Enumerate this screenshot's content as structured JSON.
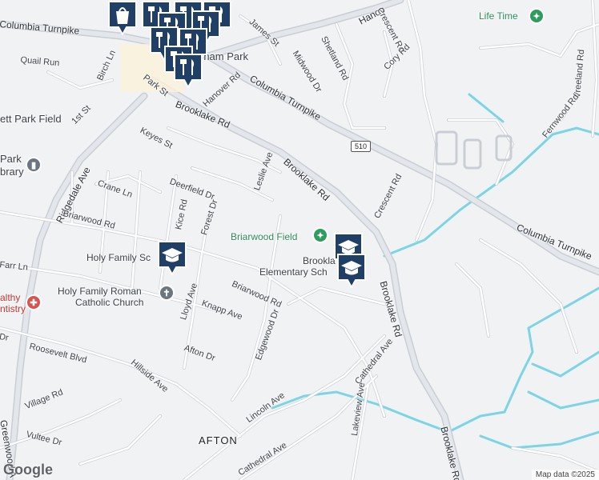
{
  "map": {
    "colors": {
      "background": "#f1f2f4",
      "road": "#ffffff",
      "major_road": "#d8dde3",
      "water": "#7cd4e6",
      "pin": "#1f3f66"
    },
    "labels": {
      "life_time": "Life Time",
      "hanover": "Hanov",
      "crescent_rd_top": "Crescent Rd",
      "james_st": "James St",
      "shetland_rd": "Shetland Rd",
      "midwood_dr": "Midwood Dr",
      "cory_rd": "Cory Rd",
      "vreeland_rd": "Vreeland Rd",
      "columbia_tpke_left": "Columbia Turnpike",
      "quail_run": "Quail Run",
      "florham_park": "rham Park",
      "birch_ln": "Birch Ln",
      "park_st": "Park St",
      "hanover_rd": "Hanover Rd",
      "columbia_tpke_mid": "Columbia Turnpike",
      "fernwood_rd": "Fernwood Rd",
      "ett_park_field": "ett Park Field",
      "first_st": "1st St",
      "brooklake_rd_top": "Brooklake Rd",
      "keyes_st": "Keyes St",
      "route_510": "510",
      "park_partial": "Park",
      "library_partial": "brary",
      "ridgedale_ave": "Ridgedale Ave",
      "crane_ln": "Crane Ln",
      "deerfield_dr": "Deerfield Dr",
      "leslie_ave": "Leslie Ave",
      "brooklake_rd_mid": "Brooklake Rd",
      "crescent_rd_mid": "Crescent Rd",
      "kice_rd": "Kice Rd",
      "forest_dr": "Forest Dr",
      "briarwood_rd_left": "Briarwood Rd",
      "briarwood_field": "Briarwood Field",
      "columbia_tpke_right": "Columbia Turnpike",
      "farr_ln": "Farr Ln",
      "holy_family_sch": "Holy Family Sc",
      "brooklake_elem_1": "Brookla",
      "brooklake_elem_2": "Elementary Sch",
      "brooklake_rd_right": "Brooklake Rd",
      "holy_family_church_1": "Holy Family Roman",
      "holy_family_church_2": "Catholic Church",
      "lloyd_ave": "Lloyd Ave",
      "briarwood_rd_mid": "Briarwood Rd",
      "knapp_ave": "Knapp Ave",
      "healthy_1": "althy",
      "healthy_2": "ntistry",
      "edgewood_dr": "Edgewood Dr",
      "afton_dr": "Afton Dr",
      "roosevelt_blvd": "Roosevelt Blvd",
      "dr_partial": "Dr",
      "cathedral_ave_right": "Cathedral Ave",
      "hillside_ave": "Hillside Ave",
      "village_rd": "Village Rd",
      "lincoln_ave": "Lincoln Ave",
      "lakeview_ave": "Lakeview Ave",
      "greenwood_ave": "Greenwood A",
      "vultee_dr": "Vultee Dr",
      "afton": "AFTON",
      "brooklake_rd_bottom": "Brooklake Rd",
      "cathedral_ave_bottom": "Cathedral Ave"
    },
    "pins": {
      "shopping": "shopping-bag",
      "restaurant": "restaurant",
      "school": "school"
    },
    "footer": {
      "logo": "Google",
      "attribution": "Map data ©2025"
    }
  }
}
